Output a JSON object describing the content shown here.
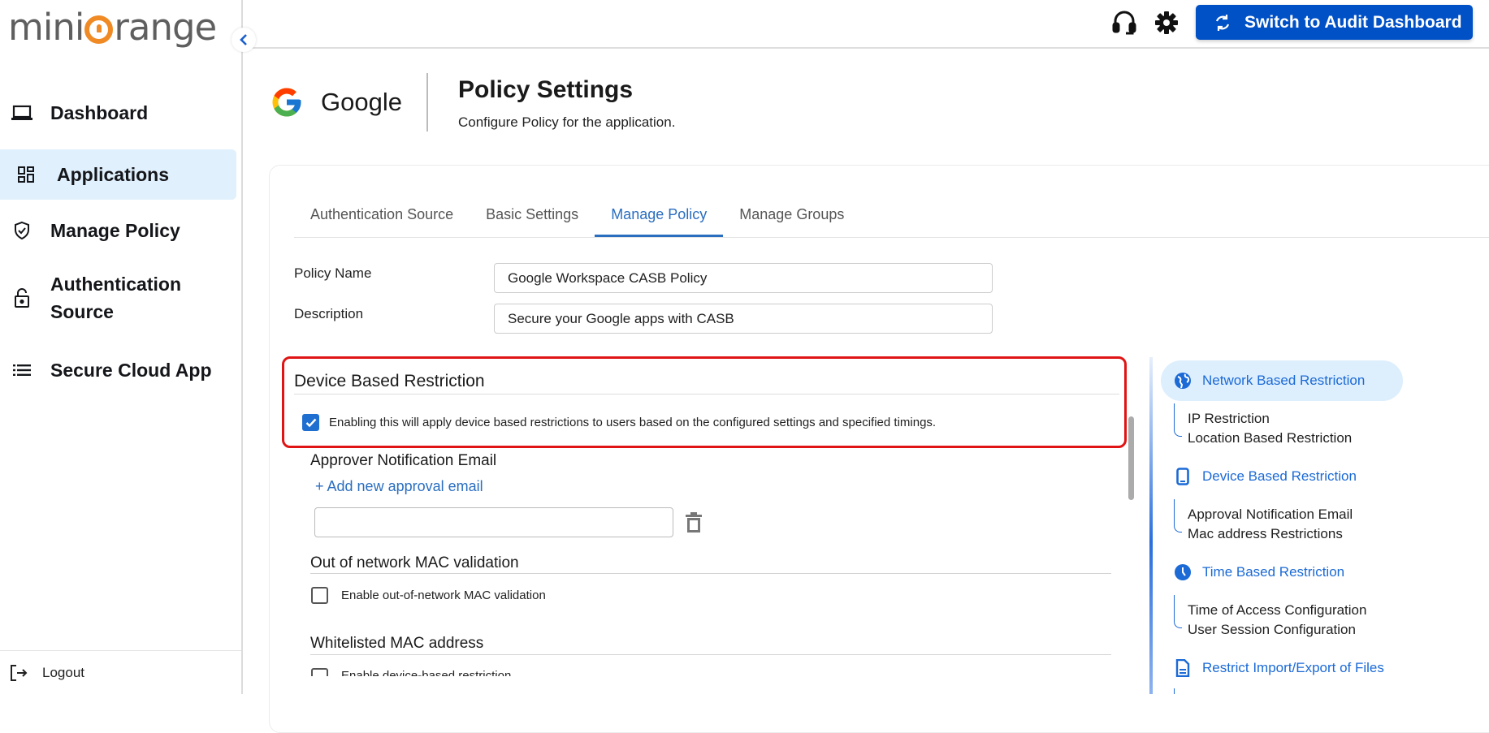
{
  "brand": {
    "logo_text_left": "mini",
    "logo_text_right": "range"
  },
  "sidebar": {
    "items": [
      {
        "label": "Dashboard",
        "icon": "laptop-icon"
      },
      {
        "label": "Applications",
        "icon": "apps-grid-icon",
        "active": true
      },
      {
        "label": "Manage Policy",
        "icon": "shield-check-icon"
      },
      {
        "label": "Authentication Source",
        "icon": "unlock-icon"
      },
      {
        "label": "Secure Cloud App",
        "icon": "list-icon"
      }
    ],
    "logout_label": "Logout"
  },
  "topbar": {
    "audit_button_label": "Switch to Audit Dashboard"
  },
  "app": {
    "name": "Google",
    "page_title": "Policy Settings",
    "page_subtitle": "Configure Policy for the application."
  },
  "tabs": [
    {
      "label": "Authentication Source"
    },
    {
      "label": "Basic Settings"
    },
    {
      "label": "Manage Policy",
      "active": true
    },
    {
      "label": "Manage Groups"
    }
  ],
  "form": {
    "policy_name_label": "Policy Name",
    "policy_name_value": "Google Workspace CASB Policy",
    "description_label": "Description",
    "description_value": "Secure your Google apps with CASB"
  },
  "device_restriction": {
    "title": "Device Based Restriction",
    "enabled": true,
    "enable_text": "Enabling this will apply device based restrictions to users based on the configured settings and specified timings.",
    "approver_title": "Approver Notification Email",
    "add_email_label": "+ Add new approval email",
    "email_value": "",
    "mac_validation_title": "Out of network MAC validation",
    "mac_validation_checkbox_label": "Enable out-of-network MAC validation",
    "mac_validation_enabled": false,
    "whitelist_title": "Whitelisted MAC address",
    "whitelist_checkbox_label": "Enable device-based restriction",
    "whitelist_enabled": false
  },
  "right_nav": {
    "sections": [
      {
        "label": "Network Based Restriction",
        "icon": "globe-icon",
        "active": true,
        "children": [
          "IP Restriction",
          "Location Based Restriction"
        ]
      },
      {
        "label": "Device Based Restriction",
        "icon": "mobile-icon",
        "children": [
          "Approval Notification Email",
          "Mac address Restrictions"
        ]
      },
      {
        "label": "Time Based Restriction",
        "icon": "clock-icon",
        "children": [
          "Time of Access Configuration",
          "User Session Configuration"
        ]
      },
      {
        "label": "Restrict Import/Export of Files",
        "icon": "document-icon",
        "children": []
      }
    ]
  },
  "colors": {
    "primary": "#0050c6",
    "accent_link": "#2a6ec0",
    "highlight_border": "#e01414",
    "active_bg": "#e0f0fd"
  }
}
